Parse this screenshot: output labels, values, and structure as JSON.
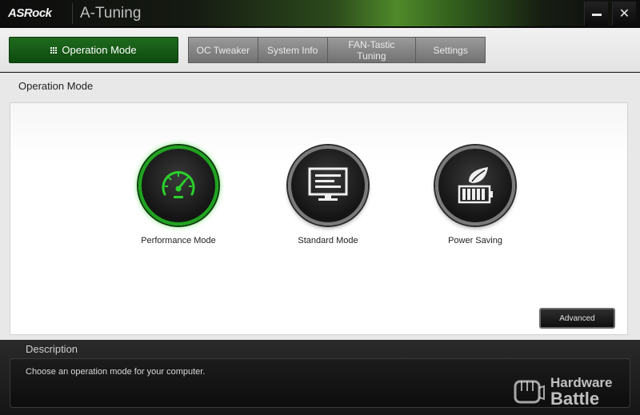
{
  "window": {
    "brand": "ASRock",
    "title": "A-Tuning",
    "minimize_label": "",
    "close_label": "✕"
  },
  "nav": {
    "operation_mode": "Operation Mode",
    "tabs": [
      {
        "label": "OC Tweaker"
      },
      {
        "label": "System Info"
      },
      {
        "label": "FAN-Tastic Tuning"
      },
      {
        "label": "Settings"
      }
    ]
  },
  "section": {
    "title": "Operation Mode",
    "modes": [
      {
        "label": "Performance Mode",
        "icon": "speedometer-icon",
        "selected": true
      },
      {
        "label": "Standard Mode",
        "icon": "monitor-icon",
        "selected": false
      },
      {
        "label": "Power Saving",
        "icon": "leaf-battery-icon",
        "selected": false
      }
    ],
    "advanced_label": "Advanced"
  },
  "description": {
    "title": "Description",
    "text": "Choose an operation mode for your computer."
  },
  "watermark": {
    "line1": "Hardware",
    "line2": "Battle"
  },
  "colors": {
    "accent": "#1fa31f",
    "active_button": "#135e13"
  }
}
